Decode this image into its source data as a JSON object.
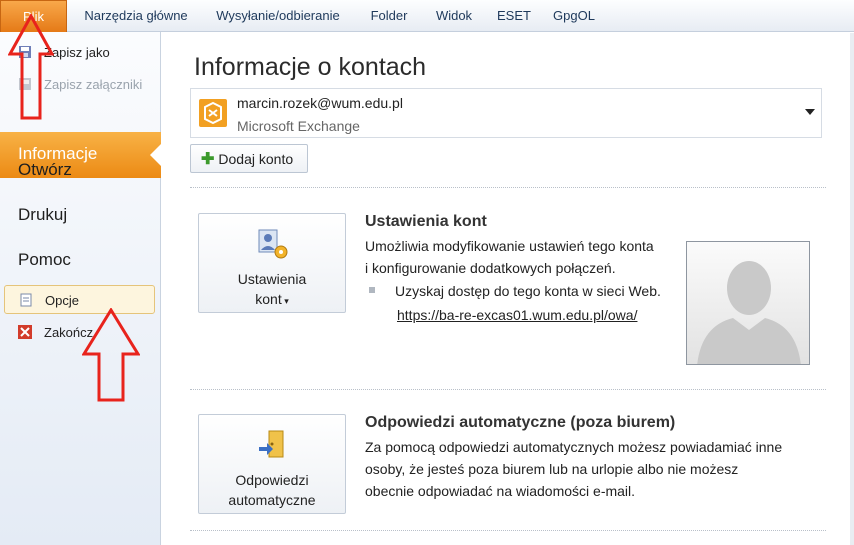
{
  "ribbon": {
    "tabs": [
      "Plik",
      "Narzędzia główne",
      "Wysyłanie/odbieranie",
      "Folder",
      "Widok",
      "ESET",
      "GpgOL"
    ]
  },
  "left": {
    "commands": {
      "save_as": "Zapisz jako",
      "save_attachments": "Zapisz załączniki"
    },
    "nav": {
      "info": "Informacje",
      "open": "Otwórz",
      "print": "Drukuj",
      "help": "Pomoc"
    },
    "options": "Opcje",
    "exit": "Zakończ"
  },
  "main": {
    "title": "Informacje o kontach",
    "account": {
      "email": "marcin.rozek@wum.edu.pl",
      "type": "Microsoft Exchange"
    },
    "add_account": "Dodaj konto",
    "account_settings": {
      "button_line1": "Ustawienia",
      "button_line2": "kont",
      "title": "Ustawienia kont",
      "desc_line1": "Umożliwia modyfikowanie ustawień tego konta",
      "desc_line2": "i konfigurowanie dodatkowych połączeń.",
      "bullet": "Uzyskaj dostęp do tego konta w sieci Web.",
      "link": "https://ba-re-excas01.wum.edu.pl/owa/"
    },
    "auto_replies": {
      "button_line1": "Odpowiedzi",
      "button_line2": "automatyczne",
      "title": "Odpowiedzi automatyczne (poza biurem)",
      "desc_line1": "Za pomocą odpowiedzi automatycznych możesz powiadamiać inne",
      "desc_line2": "osoby, że jesteś poza biurem lub na urlopie albo nie możesz",
      "desc_line3": "obecnie odpowiadać na wiadomości e-mail."
    }
  },
  "colors": {
    "accent": "#ec8a14",
    "arrow": "#e8231c",
    "link": "#222222"
  }
}
